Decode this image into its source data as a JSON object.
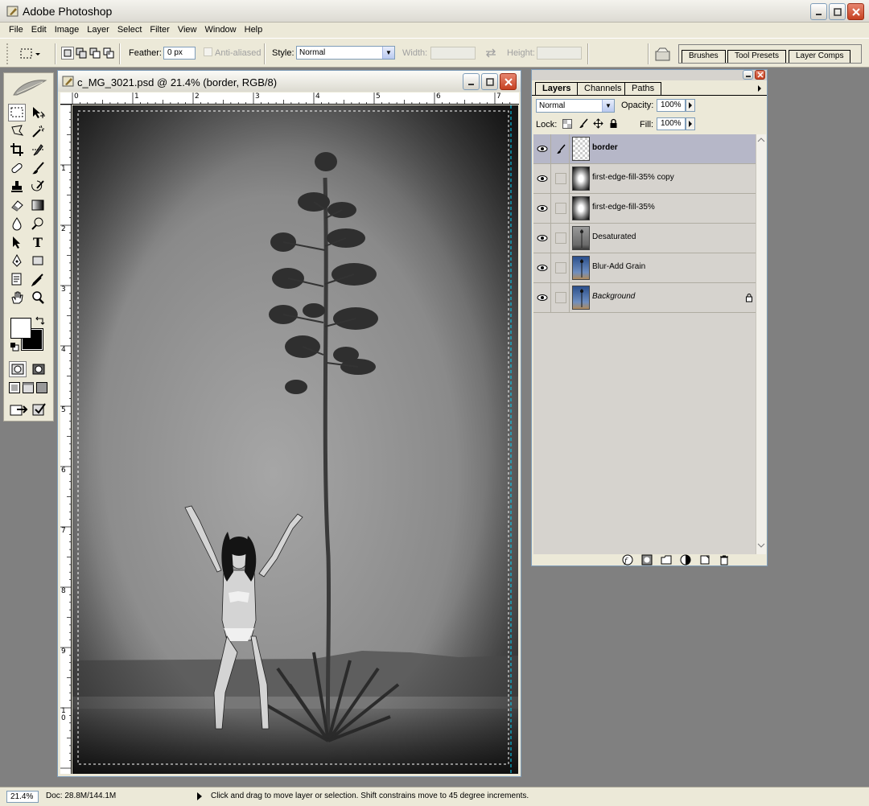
{
  "app": {
    "title": "Adobe Photoshop"
  },
  "menu": [
    "File",
    "Edit",
    "Image",
    "Layer",
    "Select",
    "Filter",
    "View",
    "Window",
    "Help"
  ],
  "options": {
    "feather_label": "Feather:",
    "feather_value": "0 px",
    "anti_aliased_label": "Anti-aliased",
    "style_label": "Style:",
    "style_value": "Normal",
    "width_label": "Width:",
    "height_label": "Height:",
    "well_tabs": [
      "Brushes",
      "Tool Presets",
      "Layer Comps"
    ]
  },
  "document": {
    "title": "c_MG_3021.psd @ 21.4% (border, RGB/8)",
    "ruler_top": [
      "0",
      "1",
      "2",
      "3",
      "4",
      "5",
      "6",
      "7"
    ],
    "ruler_left": [
      "1",
      "2",
      "3",
      "4",
      "5",
      "6",
      "7",
      "8",
      "9",
      "1\n0"
    ]
  },
  "layers_panel": {
    "tabs": [
      "Layers",
      "Channels",
      "Paths"
    ],
    "blend_mode": "Normal",
    "opacity_label": "Opacity:",
    "opacity_value": "100%",
    "lock_label": "Lock:",
    "fill_label": "Fill:",
    "fill_value": "100%",
    "layers": [
      {
        "name": "border",
        "selected": true,
        "thumb": "transparent"
      },
      {
        "name": "first-edge-fill-35% copy",
        "selected": false,
        "thumb": "radial"
      },
      {
        "name": "first-edge-fill-35%",
        "selected": false,
        "thumb": "radial"
      },
      {
        "name": "Desaturated",
        "selected": false,
        "thumb": "gray-photo"
      },
      {
        "name": "Blur-Add Grain",
        "selected": false,
        "thumb": "color-photo"
      },
      {
        "name": "Background",
        "selected": false,
        "thumb": "color-photo",
        "locked": true
      }
    ]
  },
  "status": {
    "zoom": "21.4%",
    "doc": "Doc: 28.8M/144.1M",
    "hint": "Click and drag to move layer or selection. Shift constrains move to 45 degree increments."
  },
  "colors": {
    "chrome": "#ece9d8",
    "workspace": "#808080",
    "selected_layer": "#b6b7c8"
  }
}
